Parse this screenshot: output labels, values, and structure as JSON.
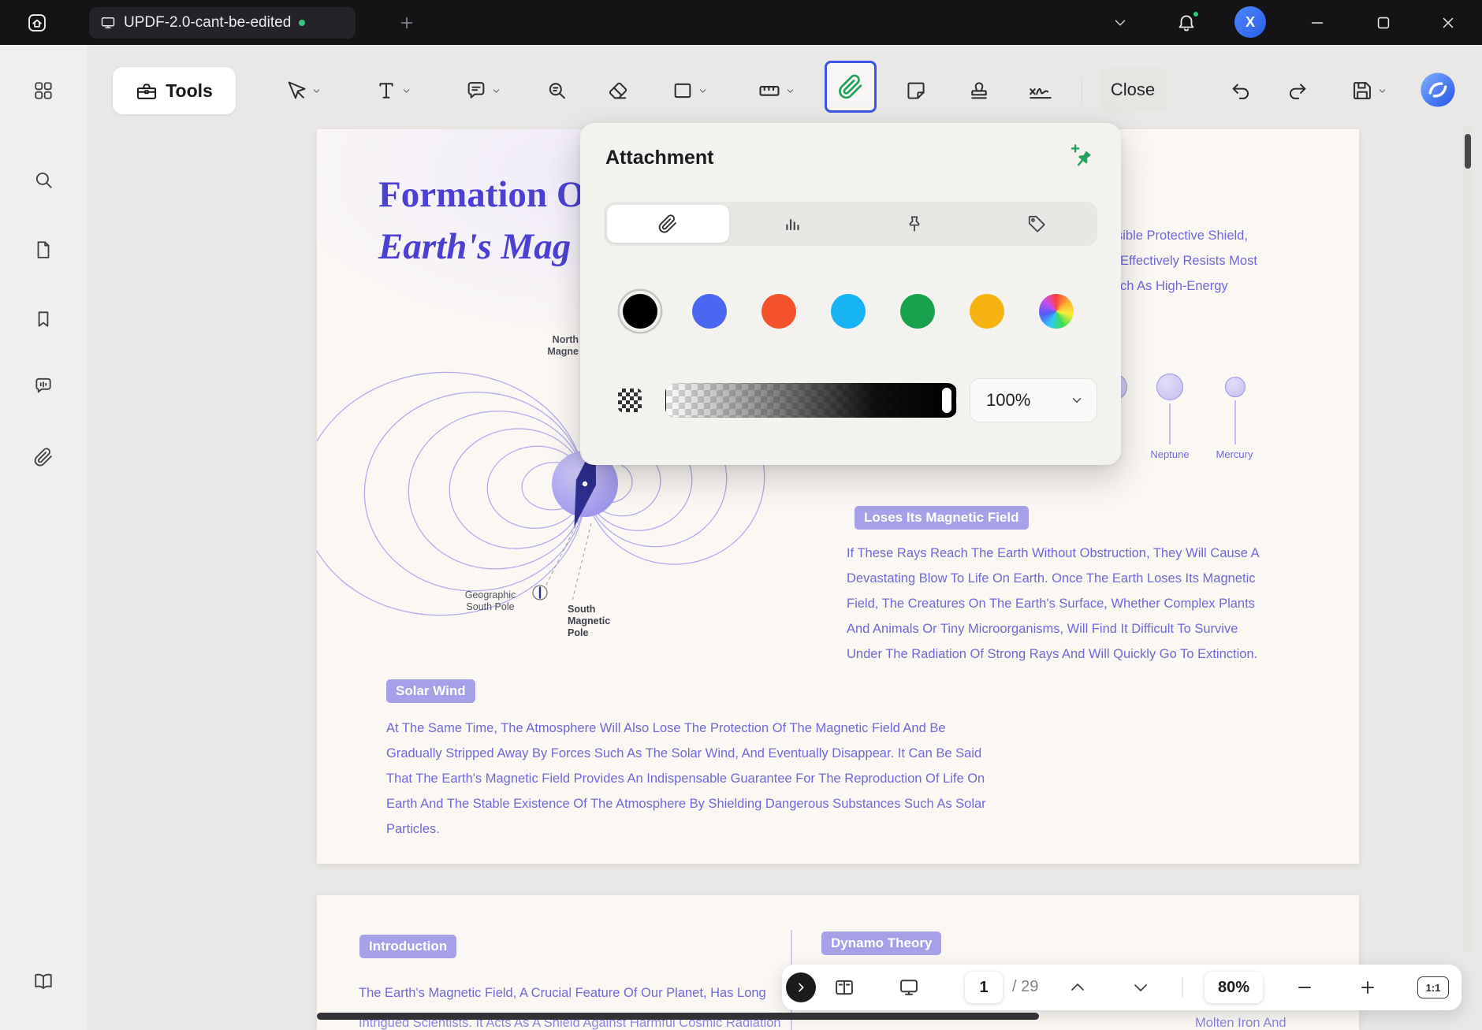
{
  "colors": {
    "titlebar_bg": "#141417",
    "app_bg": "#eae8e6",
    "accent_blue": "#3a55e2",
    "attach_green": "#23a05c",
    "heading_purple": "#4c40d4",
    "body_purple": "#6f69d9",
    "badge_purple": "#a6a0e8",
    "online_green": "#35c97d"
  },
  "icon_names": [
    "home-icon",
    "monitor-icon",
    "add-tab-icon",
    "chevron-down-icon",
    "bell-icon",
    "minimize-icon",
    "maximize-icon",
    "close-icon",
    "grid-icon",
    "search-icon",
    "document-icon",
    "bookmark-icon",
    "comment-icon",
    "paperclip-icon",
    "reader-icon",
    "toolbox-icon",
    "cursor-icon",
    "text-tool-icon",
    "annotate-icon",
    "search-text-icon",
    "eraser-icon",
    "square-icon",
    "ruler-icon",
    "sticker-icon",
    "stamp-icon",
    "signature-icon",
    "undo-icon",
    "redo-icon",
    "save-icon",
    "ai-assistant-icon",
    "pin-add-icon",
    "chart-icon",
    "pushpin-icon",
    "tag-icon",
    "next-page-icon",
    "book-view-icon",
    "present-icon",
    "chevron-up-icon",
    "minus-icon",
    "plus-icon"
  ],
  "titlebar": {
    "tab_title": "UPDF-2.0-cant-be-edited",
    "avatar_initial": "X"
  },
  "toolbar": {
    "tools_label": "Tools",
    "close_label": "Close"
  },
  "attachment_panel": {
    "title": "Attachment",
    "opacity_value": "100%",
    "swatch_colors": [
      "#000000",
      "#4a67f1",
      "#f4512d",
      "#18b3f4",
      "#18a24b",
      "#f6b211",
      "conic"
    ]
  },
  "page1": {
    "title_line1": "Formation O",
    "title_line2": "Earth's Mag",
    "label_north_1": "North",
    "label_north_2": "Magne",
    "label_geo_1": "Geographic",
    "label_geo_2": "South Pole",
    "label_south_1": "South",
    "label_south_2": "Magnetic",
    "label_south_3": "Pole",
    "frag_right_1": "sible Protective Shield,",
    "frag_right_2": "Effectively Resists Most",
    "frag_right_3": "ch As High-Energy",
    "planet_1": "Neptune",
    "planet_2": "Mercury",
    "badge_loses": "Loses Its Magnetic Field",
    "para_loses": "If These Rays Reach The Earth Without Obstruction, They Will Cause A Devastating Blow To Life On Earth. Once The Earth Loses Its Magnetic Field, The Creatures On The Earth's Surface, Whether Complex Plants And Animals Or Tiny Microorganisms, Will Find It Difficult To Survive Under The Radiation Of Strong Rays And Will Quickly Go To Extinction.",
    "badge_solar": "Solar Wind",
    "para_solar": "At The Same Time, The Atmosphere Will Also Lose The Protection Of The Magnetic Field And Be Gradually Stripped Away By Forces Such As The Solar Wind, And Eventually Disappear. It Can Be Said That The Earth's Magnetic Field Provides An Indispensable Guarantee For The Reproduction Of Life On Earth And The Stable Existence Of The Atmosphere By Shielding Dangerous Substances Such As Solar Particles."
  },
  "page2": {
    "badge_intro": "Introduction",
    "badge_dynamo": "Dynamo Theory",
    "line1": "The Earth's Magnetic Field, A Crucial Feature Of Our Planet, Has Long",
    "line2": "Intrigued Scientists. It Acts As A Shield Against Harmful Cosmic Radiation",
    "frag_right": "Molten Iron And"
  },
  "bottom_bar": {
    "page_current": "1",
    "page_total": "/ 29",
    "zoom": "80%",
    "fit_label": "1:1"
  }
}
